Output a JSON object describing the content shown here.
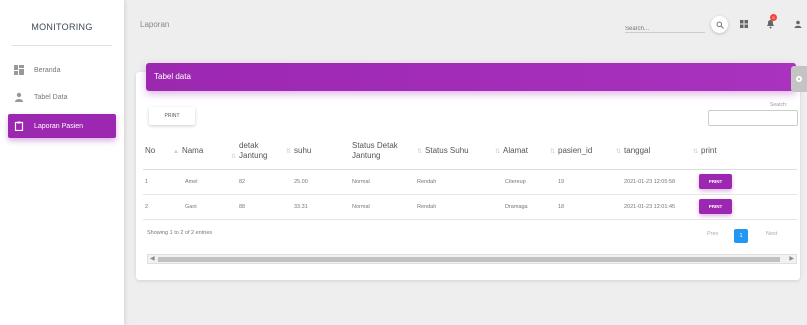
{
  "sidebar": {
    "brand": "MONITORING",
    "items": [
      {
        "label": "Beranda",
        "icon": "dashboard-icon",
        "active": false
      },
      {
        "label": "Tabel Data",
        "icon": "person-icon",
        "active": false
      },
      {
        "label": "Laporan Pasien",
        "icon": "content-paste-icon",
        "active": true
      }
    ]
  },
  "topbar": {
    "title": "Laporan",
    "search_placeholder": "Search...",
    "icons": [
      "search-icon",
      "dashboard-icon",
      "notifications-icon",
      "person-icon"
    ],
    "notification_count": "5"
  },
  "card": {
    "title": "Tabel data",
    "print_label": "PRINT",
    "search_label": "Search:"
  },
  "table": {
    "columns": [
      "No",
      "Nama",
      "detak Jantung",
      "suhu",
      "Status Detak Jantung",
      "Status Suhu",
      "Alamat",
      "pasien_id",
      "tanggal",
      "print"
    ],
    "rows": [
      {
        "no": "1",
        "nama": "Amel",
        "detak": "82",
        "suhu": "25.00",
        "status_detak": "Normal",
        "status_suhu": "Rendah",
        "alamat": "Citereup",
        "pasien_id": "19",
        "tanggal": "2021-01-23 12:05:58",
        "print": "PRINT"
      },
      {
        "no": "2",
        "nama": "Gani",
        "detak": "88",
        "suhu": "33.31",
        "status_detak": "Normal",
        "status_suhu": "Rendah",
        "alamat": "Dramaga",
        "pasien_id": "18",
        "tanggal": "2021-01-23 12:01:45",
        "print": "PRINT"
      }
    ]
  },
  "footer": {
    "info": "Showing 1 to 2 of 2 entries",
    "prev": "Prev",
    "page": "1",
    "next": "Next"
  },
  "colors": {
    "accent": "#9c27b0",
    "pagination": "#2196f3"
  }
}
